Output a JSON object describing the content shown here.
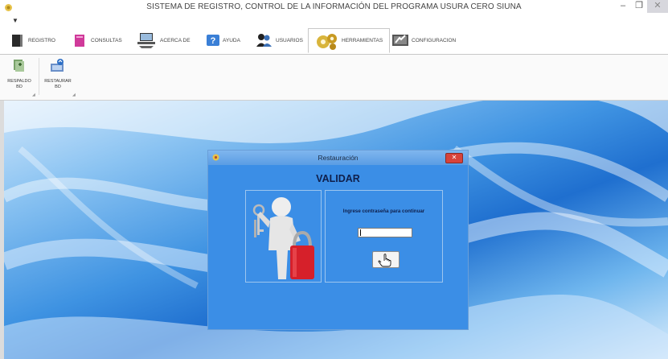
{
  "window": {
    "title": "SISTEMA DE REGISTRO, CONTROL DE LA INFORMACIÓN DEL PROGRAMA USURA CERO SIUNA",
    "controls": [
      "minimize",
      "restore",
      "close"
    ]
  },
  "tabs": [
    {
      "label": "REGISTRO",
      "icon": "door-icon"
    },
    {
      "label": "CONSULTAS",
      "icon": "book-icon"
    },
    {
      "label": "ACERCA DE",
      "icon": "laptop-icon"
    },
    {
      "label": "AYUDA",
      "icon": "help-icon"
    },
    {
      "label": "USUARIOS",
      "icon": "users-icon"
    },
    {
      "label": "HERRAMIENTAS",
      "icon": "gears-icon",
      "active": true
    },
    {
      "label": "CONFIGURACION",
      "icon": "config-icon"
    }
  ],
  "ribbon": {
    "buttons": [
      {
        "label": "RESPALDO\nBD",
        "icon": "backup-icon"
      },
      {
        "label": "RESTAURAR\nBD",
        "icon": "restore-icon"
      }
    ]
  },
  "dialog": {
    "title": "Restauración",
    "heading": "VALIDAR",
    "prompt": "Ingrese contraseña para continuar",
    "password_value": "",
    "ok_icon": "hand-pointer-icon",
    "colors": {
      "background": "#3b8ee6",
      "heading": "#0f1f4b"
    }
  }
}
